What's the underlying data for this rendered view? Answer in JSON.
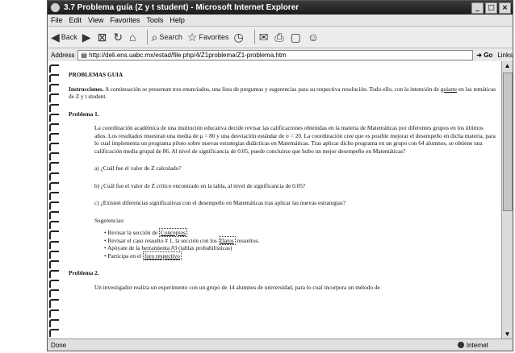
{
  "window": {
    "title": "3.7 Problema guía (Z y t student) - Microsoft Internet Explorer",
    "controls": [
      "_",
      "□",
      "×"
    ]
  },
  "menu": [
    "File",
    "Edit",
    "View",
    "Favorites",
    "Tools",
    "Help"
  ],
  "toolbar": {
    "back": "Back",
    "search": "Search",
    "favorites": "Favorites"
  },
  "address": {
    "label": "Address",
    "url": "http://deli.ens.uabc.mx/estad/file.php/4/Z1problema/Z1-problema.htm",
    "go": "Go",
    "links": "Links"
  },
  "content": {
    "heading": "PROBLEMAS GUIA",
    "instructions_label": "Instrucciones.",
    "instructions_text": " A continuación se presentan tres enunciados, una lista de preguntas y sugerencias para su respectiva resolución. Todo ello, con la intención de ",
    "instructions_link": "guiarte",
    "instructions_end": " en las temáticas de Z y t student.",
    "p1_heading": "Problema 1.",
    "p1_text": "La coordinación académica de una institución educativa decide revisar las calificaciones obtenidas en la materia de Matemáticas por diferentes grupos en los últimos años. Los resultados muestran una media de μ = 80 y una desviación estándar de σ = 20. La coordinación cree que es posible mejorar el desempeño en dicha materia, para lo cual implementa un programa piloto sobre nuevas estrategias didácticas en Matemáticas. Tras aplicar dicho programa en un grupo con 64 alumnos, se obtiene una calificación media grupal de 86. Al nivel de significancia de 0.05, puede concluirse que hubo un mejor desempeño en Matemáticas?",
    "q_a": "a) ¿Cuál fue el valor de Z calculado?",
    "q_b": "b) ¿Cuál fue el valor de Z crítico encontrado en la tabla, al nivel de significancia de 0.05?",
    "q_c": "c) ¿Existen diferencias significativas con el desempeño en Matemáticas tras aplicar las nuevas estrategias?",
    "sugerencias": "Sugerencias:",
    "s1_pre": "Revisar la sección de ",
    "s1_link": "Conceptos",
    "s2_pre": "Revisar el caso resuelto # 1, la sección con los ",
    "s2_link": "Datos",
    "s2_post": " resueltos.",
    "s3": "Apóyate de la herramienta #3 (tablas probabilísticas)",
    "s4_pre": "Participa en el ",
    "s4_link": "foro respectivo",
    "p2_heading": "Problema 2.",
    "p2_text": "Un investigador realiza un experimento con un grupo de 14 alumnos de universidad, para lo cual incorpora un método de"
  },
  "status": {
    "left": "Done",
    "zone": "Internet"
  }
}
